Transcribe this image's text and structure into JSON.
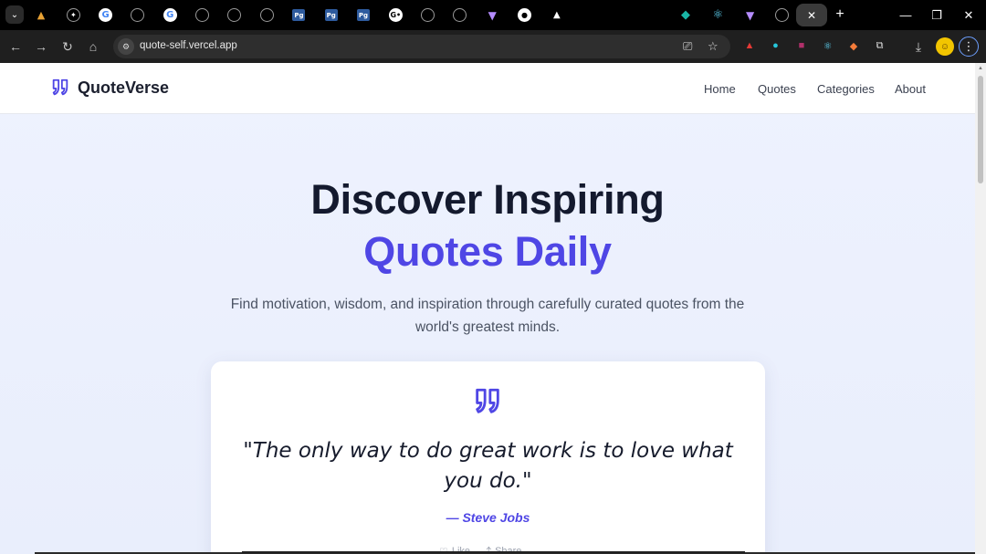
{
  "browser": {
    "tabs": [
      {
        "icon": "menu-chevron-icon",
        "glyph": "⌄"
      },
      {
        "icon": "mountain-icon",
        "glyph": "▲"
      },
      {
        "icon": "openai-icon",
        "glyph": "✦"
      },
      {
        "icon": "google-icon",
        "glyph": "G"
      },
      {
        "icon": "globe-icon",
        "glyph": ""
      },
      {
        "icon": "google-icon",
        "glyph": "G"
      },
      {
        "icon": "globe-icon",
        "glyph": ""
      },
      {
        "icon": "globe-icon",
        "glyph": ""
      },
      {
        "icon": "globe-icon",
        "glyph": ""
      },
      {
        "icon": "pg-icon",
        "glyph": "Pg"
      },
      {
        "icon": "pg-icon",
        "glyph": "Pg"
      },
      {
        "icon": "pg-icon",
        "glyph": "Pg"
      },
      {
        "icon": "dots-icon",
        "glyph": "G•"
      },
      {
        "icon": "globe-icon",
        "glyph": ""
      },
      {
        "icon": "globe-icon",
        "glyph": ""
      },
      {
        "icon": "vite-icon",
        "glyph": "▼"
      },
      {
        "icon": "github-icon",
        "glyph": "●"
      },
      {
        "icon": "triangle-icon",
        "glyph": "▲"
      },
      {
        "icon": "apple-icon",
        "glyph": ""
      },
      {
        "icon": "apple-icon",
        "glyph": ""
      },
      {
        "icon": "apple-icon",
        "glyph": ""
      },
      {
        "icon": "diamond-icon",
        "glyph": "◆"
      },
      {
        "icon": "react-icon",
        "glyph": "⚛"
      },
      {
        "icon": "vite-icon",
        "glyph": "▼"
      },
      {
        "icon": "globe-icon",
        "glyph": ""
      }
    ],
    "active_tab_close": "✕",
    "new_tab": "+",
    "window_controls": {
      "minimize": "—",
      "restore": "❐",
      "close": "✕"
    },
    "url": "quote-self.vercel.app",
    "extensions": [
      {
        "icon": "ghost-red-icon",
        "glyph": "▲",
        "color": "#e53935"
      },
      {
        "icon": "ghost-teal-icon",
        "glyph": "●",
        "color": "#26c6da"
      },
      {
        "icon": "photo-icon",
        "glyph": "■",
        "color": "#b0306a"
      },
      {
        "icon": "react-icon",
        "glyph": "⚛",
        "color": "#61dafb"
      },
      {
        "icon": "fox-icon",
        "glyph": "◆",
        "color": "#f57c3a"
      },
      {
        "icon": "puzzle-icon",
        "glyph": "⧉",
        "color": "#dddddd"
      }
    ]
  },
  "site": {
    "brand": "QuoteVerse",
    "nav": [
      "Home",
      "Quotes",
      "Categories",
      "About"
    ],
    "hero": {
      "line1": "Discover Inspiring",
      "line2": "Quotes Daily",
      "subtitle": "Find motivation, wisdom, and inspiration through carefully curated quotes from the world's greatest minds."
    },
    "featured": {
      "quote": "\"The only way to do great work is to love what you do.\"",
      "author": "— Steve Jobs",
      "like_label": "Like",
      "share_label": "Share"
    },
    "colors": {
      "accent": "#4f46e5",
      "heading": "#141a2e",
      "background": "#eef2fe"
    }
  }
}
